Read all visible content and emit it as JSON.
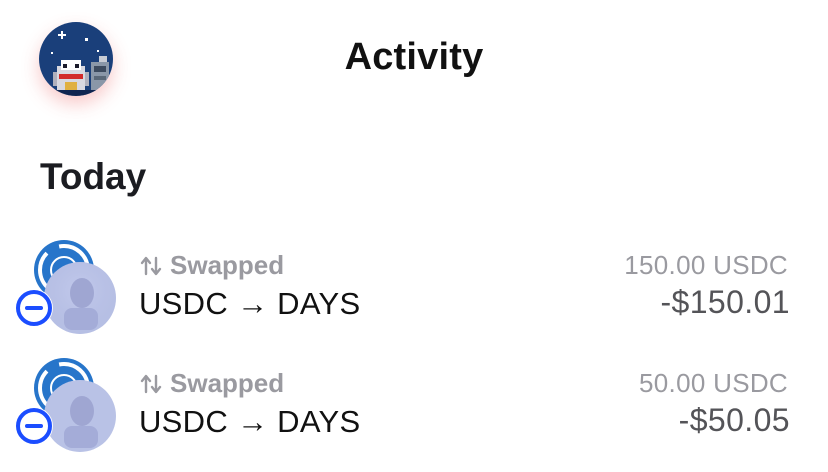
{
  "header": {
    "title": "Activity",
    "avatar_icon": "pixel-art-avatar-icon"
  },
  "section": {
    "title": "Today"
  },
  "transactions": [
    {
      "type_label": "Swapped",
      "type_icon": "swap-arrows-icon",
      "pair": "USDC → DAYS",
      "amount": "150.00 USDC",
      "value": "-$150.01"
    },
    {
      "type_label": "Swapped",
      "type_icon": "swap-arrows-icon",
      "pair": "USDC → DAYS",
      "amount": "50.00 USDC",
      "value": "-$50.05"
    }
  ],
  "colors": {
    "usdc_blue": "#2775ca",
    "badge_blue": "#1b4dff",
    "muted_text": "#9a9aa0",
    "value_text": "#545458"
  }
}
